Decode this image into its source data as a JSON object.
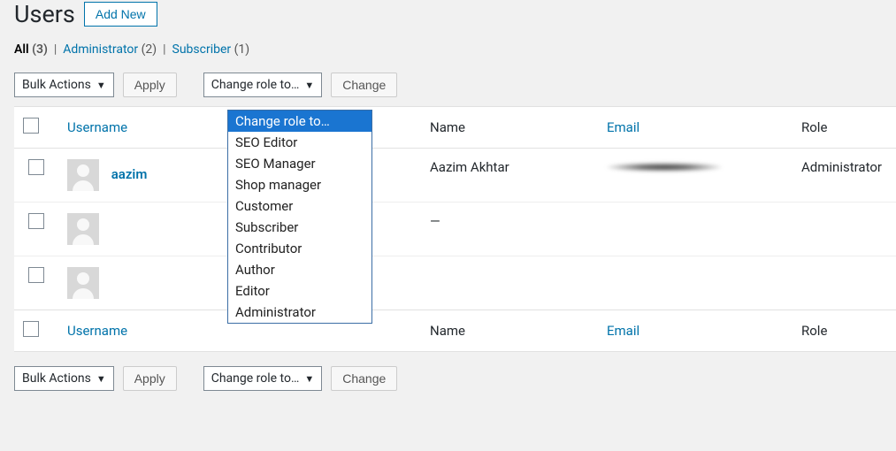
{
  "header": {
    "title": "Users",
    "addNew": "Add New"
  },
  "filters": {
    "all": {
      "label": "All",
      "count": "(3)"
    },
    "admin": {
      "label": "Administrator",
      "count": "(2)"
    },
    "subscriber": {
      "label": "Subscriber",
      "count": "(1)"
    }
  },
  "bulk": {
    "label": "Bulk Actions",
    "apply": "Apply"
  },
  "roleChange": {
    "label": "Change role to…",
    "button": "Change"
  },
  "roleOptions": [
    "Change role to…",
    "SEO Editor",
    "SEO Manager",
    "Shop manager",
    "Customer",
    "Subscriber",
    "Contributor",
    "Author",
    "Editor",
    "Administrator"
  ],
  "columns": {
    "username": "Username",
    "name": "Name",
    "email": "Email",
    "role": "Role"
  },
  "rows": [
    {
      "username": "aazim",
      "name": "Aazim Akhtar",
      "email": "",
      "role": "Administrator",
      "emailBlurred": true
    },
    {
      "username": "",
      "name": "—",
      "email": "",
      "role": ""
    },
    {
      "username": "",
      "name": "",
      "email": "",
      "role": ""
    }
  ]
}
